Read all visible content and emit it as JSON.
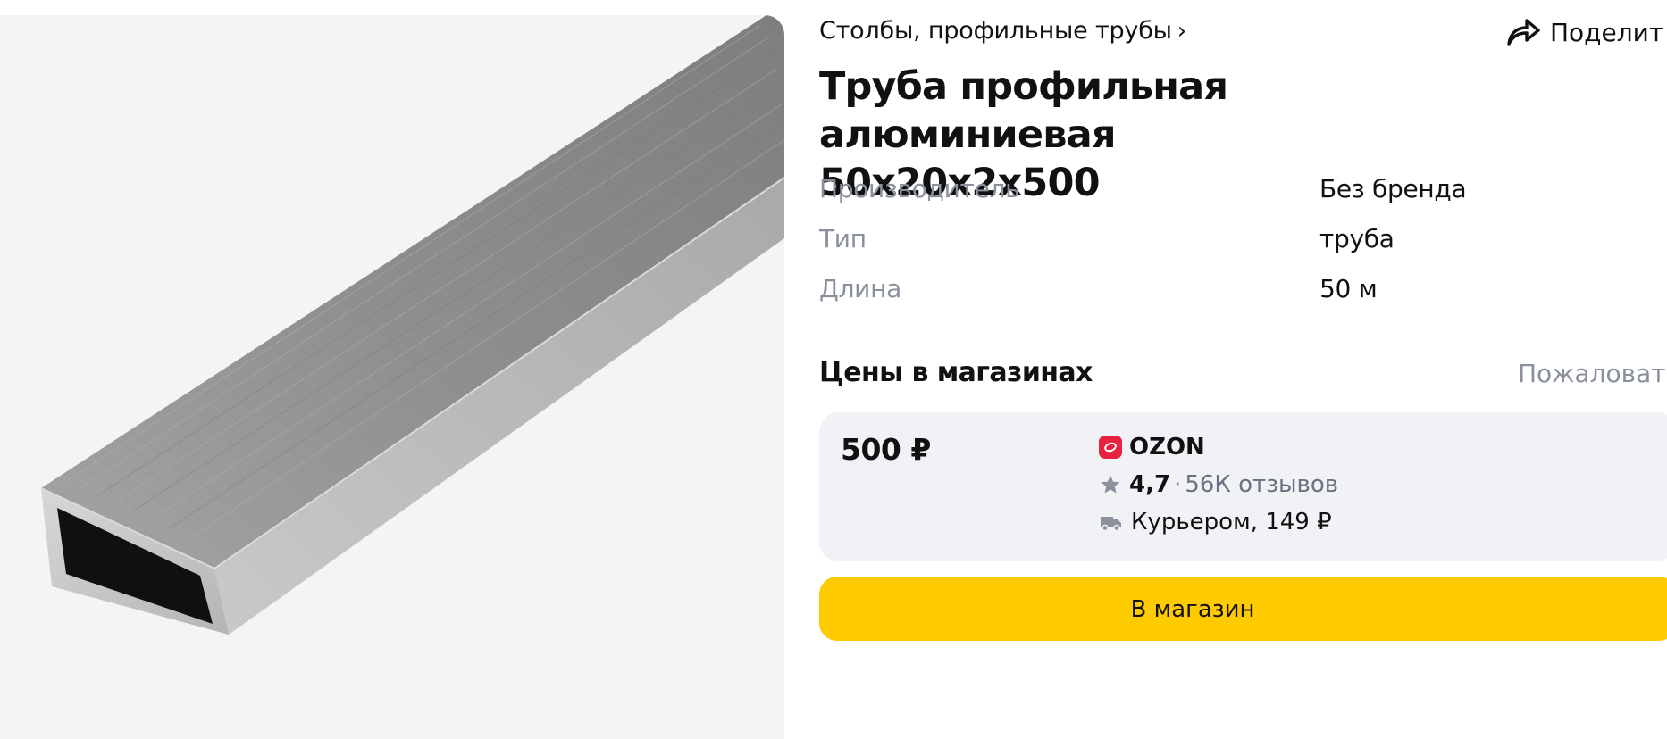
{
  "breadcrumb": {
    "label": "Столбы, профильные трубы",
    "chevron": "›"
  },
  "share": {
    "label": "Поделит",
    "icon": "share-icon"
  },
  "product": {
    "title_line1": "Труба профильная алюминиевая",
    "title_line2": "50х20х2х500",
    "image": "aluminum-rectangular-tube-photo",
    "specs": [
      {
        "name": "Производитель",
        "value": "Без бренда"
      },
      {
        "name": "Тип",
        "value": "труба"
      },
      {
        "name": "Длина",
        "value": "50 м"
      }
    ]
  },
  "prices": {
    "heading": "Цены в магазинах",
    "complain_label": "Пожаловат"
  },
  "offer": {
    "price": "500 ₽",
    "shop_name": "OZON",
    "shop_icon": "ozon-logo-icon",
    "rating": "4,7",
    "rating_separator": "·",
    "reviews": "56К отзывов",
    "rating_icon": "star-icon",
    "delivery": "Курьером, 149 ₽",
    "delivery_icon": "truck-icon"
  },
  "store_button": {
    "label": "В магазин"
  },
  "colors": {
    "accent_button": "#fecb00",
    "muted_text": "#8a909c",
    "card_background": "#f0f2f5",
    "ozon_brand": "#e8213f"
  }
}
